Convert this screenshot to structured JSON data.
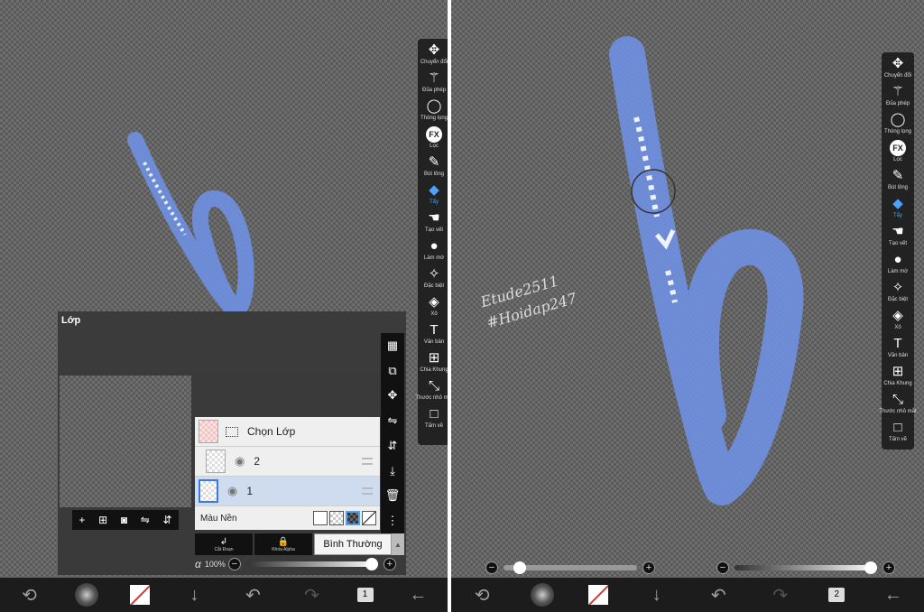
{
  "tools": [
    {
      "name": "move-tool",
      "icon": "✥",
      "label": "Chuyển đổi"
    },
    {
      "name": "magic-wand-tool",
      "icon": "⚚",
      "label": "Đũa phép"
    },
    {
      "name": "lasso-tool",
      "icon": "◯",
      "label": "Thòng lọng"
    },
    {
      "name": "filter-tool",
      "icon": "FX",
      "label": "Lọc"
    },
    {
      "name": "brush-tool",
      "icon": "✎",
      "label": "Bút lông"
    },
    {
      "name": "eraser-tool",
      "icon": "◆",
      "label": "Tẩy",
      "active": true
    },
    {
      "name": "smudge-tool",
      "icon": "☚",
      "label": "Tạo vết"
    },
    {
      "name": "blur-tool",
      "icon": "●",
      "label": "Làm mờ"
    },
    {
      "name": "special-tool",
      "icon": "✧",
      "label": "Đặc biệt"
    },
    {
      "name": "fill-tool",
      "icon": "◈",
      "label": "Xô"
    },
    {
      "name": "text-tool",
      "icon": "T",
      "label": "Văn bản"
    },
    {
      "name": "frame-tool",
      "icon": "⊞",
      "label": "Chia Khung"
    },
    {
      "name": "eyedropper-tool",
      "icon": "⤡",
      "label": "Thước nhỏ mắt"
    },
    {
      "name": "canvas-tool",
      "icon": "□",
      "label": "Tấm vẽ"
    }
  ],
  "layer_panel": {
    "title": "Lớp",
    "select_layer": "Chọn Lớp",
    "layers": [
      {
        "name": "2",
        "selected": false
      },
      {
        "name": "1",
        "selected": true
      }
    ],
    "background_label": "Màu Nền",
    "clip_label": "Cắt Đoạn",
    "alpha_lock_label": "Khóa Alpha",
    "blend_mode": "Bình Thường",
    "opacity_symbol": "α",
    "opacity": "100%",
    "opacity_fraction": 1.0
  },
  "watermark": [
    "Etude2511",
    "#Hoidap247"
  ],
  "right_sliders": {
    "brush_size_fraction": 0.08,
    "brush_opacity_fraction": 1.0
  },
  "pages": {
    "left": "1",
    "right": "2"
  },
  "colors": {
    "stroke": "#6f8edb",
    "accent": "#4aa3ff"
  }
}
